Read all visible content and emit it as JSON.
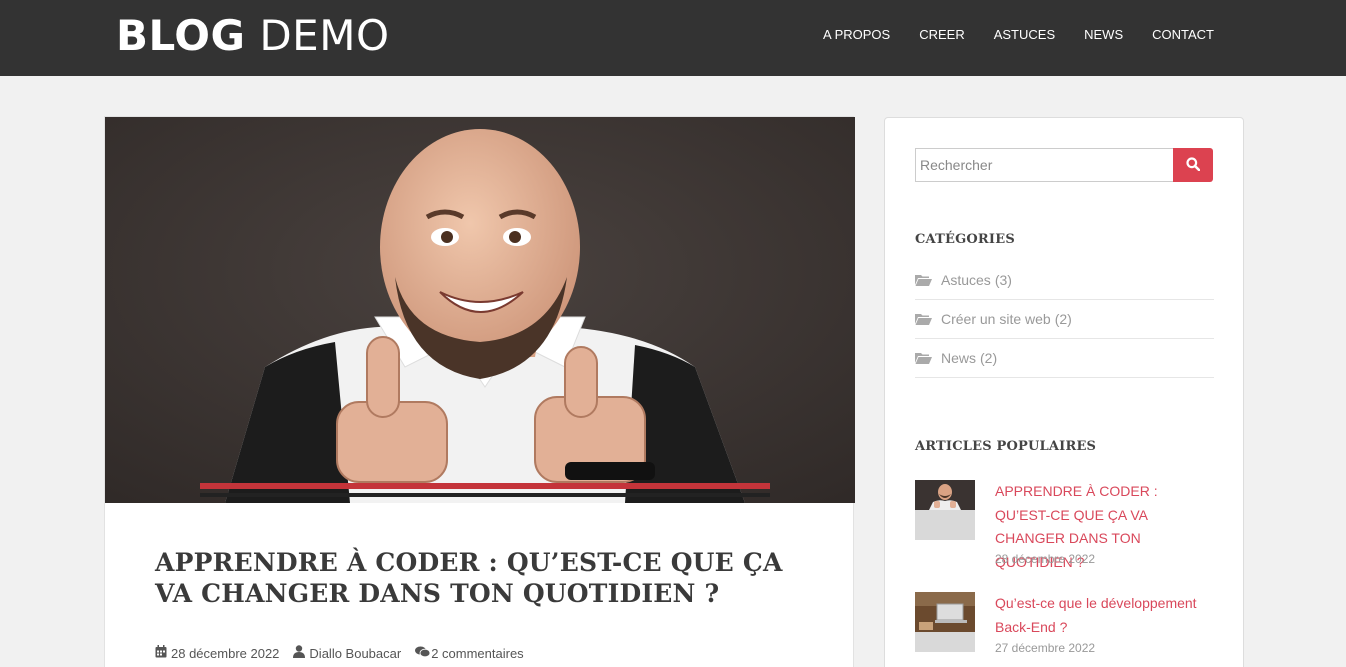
{
  "header": {
    "brand_bold": "BLOG",
    "brand_light": "DEMO",
    "nav": [
      "A PROPOS",
      "CREER",
      "ASTUCES",
      "NEWS",
      "CONTACT"
    ]
  },
  "post": {
    "title": "APPRENDRE À CODER : QU’EST-CE QUE ÇA VA CHANGER DANS TON QUOTIDIEN ?",
    "date": "28 décembre 2022",
    "author": "Diallo Boubacar",
    "comments": "2 commentaires",
    "icons": [
      "calendar-icon",
      "user-icon",
      "comments-icon"
    ]
  },
  "sidebar": {
    "search": {
      "placeholder": "Rechercher",
      "value": "",
      "button_icon": "search-icon"
    },
    "categories_title": "CATÉGORIES",
    "categories": [
      {
        "name": "Astuces",
        "count": "(3)"
      },
      {
        "name": "Créer un site web",
        "count": "(2)"
      },
      {
        "name": "News",
        "count": "(2)"
      }
    ],
    "popular_title": "ARTICLES POPULAIRES",
    "popular": [
      {
        "title": "APPRENDRE À CODER : QU’EST-CE QUE ÇA VA CHANGER DANS TON QUOTIDIEN ?",
        "date": "28 décembre 2022"
      },
      {
        "title": "Qu’est-ce que le développement Back-End ?",
        "date": "27 décembre 2022"
      }
    ]
  },
  "colors": {
    "header_bg": "#333333",
    "page_bg": "#f1f1f1",
    "accent": "#dc4250",
    "link": "#d9485b"
  }
}
